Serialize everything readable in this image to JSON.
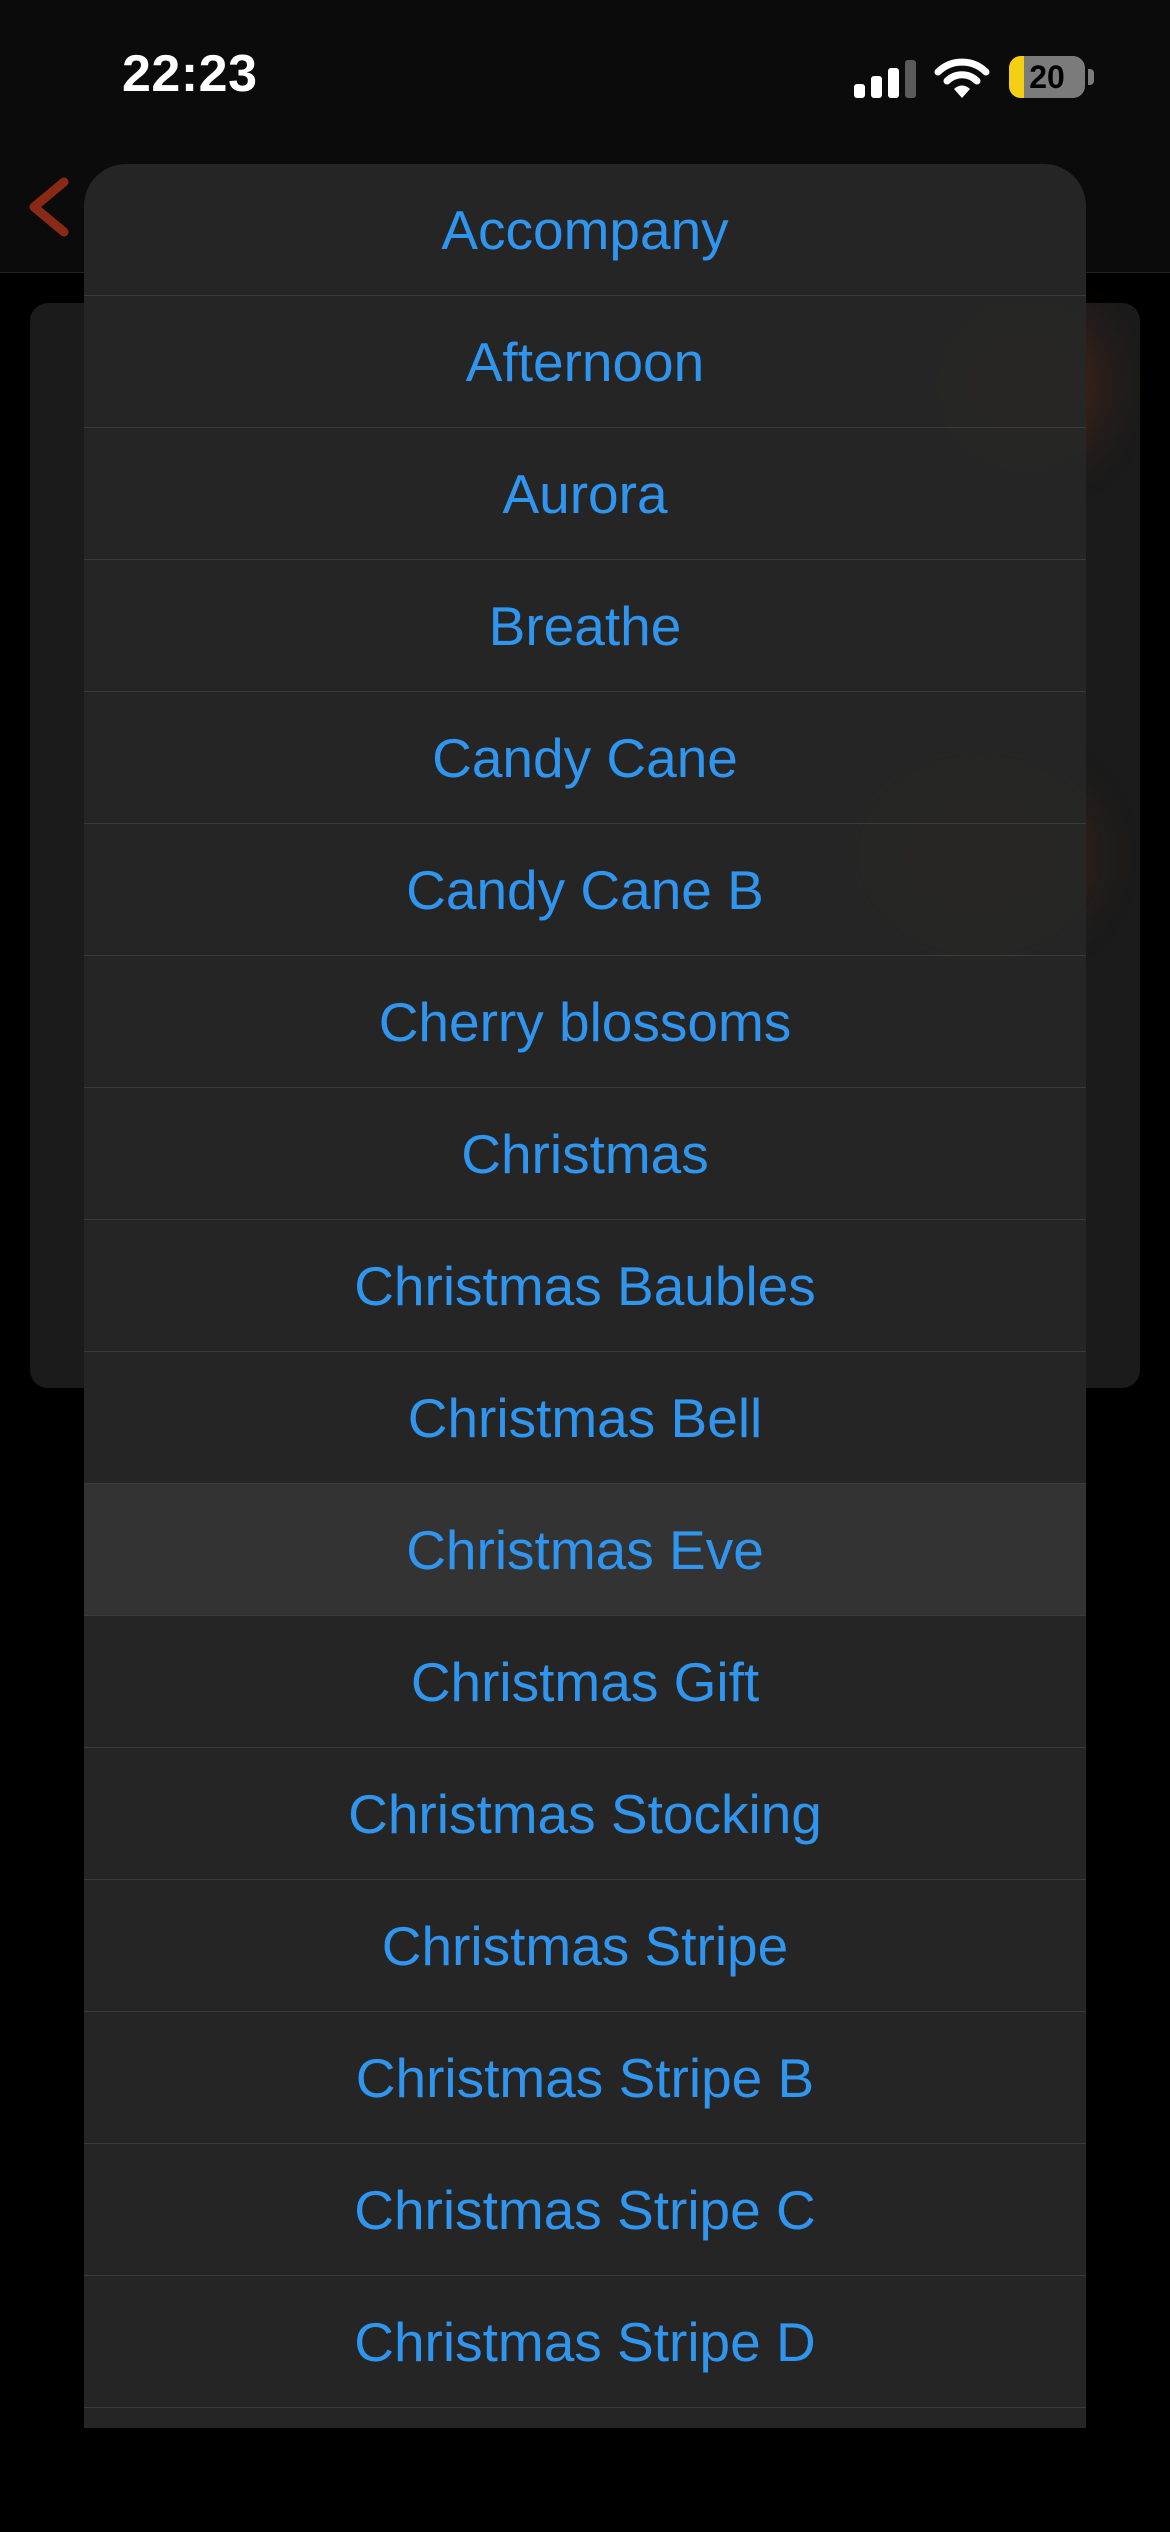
{
  "status_bar": {
    "time": "22:23",
    "battery_level": 20,
    "battery_text": "20",
    "battery_color": "#f5cf13",
    "signal_bars_active": 3,
    "signal_bars_total": 4
  },
  "background": {
    "back_icon": "chevron-left-icon",
    "accent_color": "#c8361c"
  },
  "sheet": {
    "text_color": "#2f95ee",
    "highlighted_index": 10,
    "options": [
      {
        "label": "Accompany"
      },
      {
        "label": "Afternoon"
      },
      {
        "label": "Aurora"
      },
      {
        "label": "Breathe"
      },
      {
        "label": "Candy Cane"
      },
      {
        "label": "Candy Cane B"
      },
      {
        "label": "Cherry blossoms"
      },
      {
        "label": "Christmas"
      },
      {
        "label": "Christmas Baubles"
      },
      {
        "label": "Christmas Bell"
      },
      {
        "label": "Christmas Eve"
      },
      {
        "label": "Christmas Gift"
      },
      {
        "label": "Christmas Stocking"
      },
      {
        "label": "Christmas Stripe"
      },
      {
        "label": "Christmas Stripe B"
      },
      {
        "label": "Christmas Stripe C"
      },
      {
        "label": "Christmas Stripe D"
      }
    ]
  }
}
